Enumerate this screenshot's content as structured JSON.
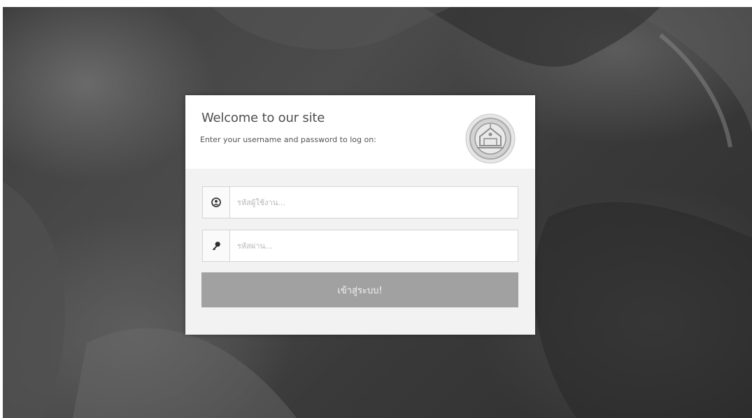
{
  "login": {
    "title": "Welcome to our site",
    "subtitle": "Enter your username and password to log on:",
    "username": {
      "placeholder": "รหัสผู้ใช้งาน...",
      "value": "",
      "icon": "user-icon"
    },
    "password": {
      "placeholder": "รหัสผ่าน...",
      "value": "",
      "icon": "key-icon"
    },
    "submit_label": "เข้าสู่ระบบ!",
    "logo": "emblem-logo"
  },
  "colors": {
    "card_background": "#f2f2f3",
    "button_background": "#a1a1a1",
    "button_text": "#f3f3f3",
    "title_text": "#4f4f4f"
  }
}
